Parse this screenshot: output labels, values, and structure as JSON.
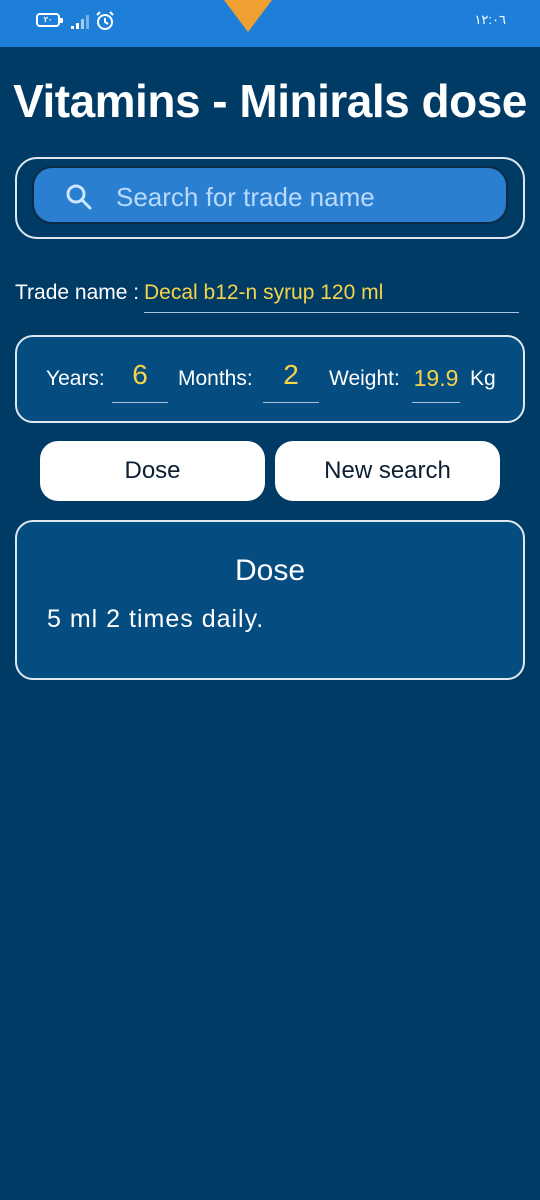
{
  "status_bar": {
    "battery_text": "٢٠",
    "time": "١٢:٠٦",
    "battery_icon": "battery-icon",
    "signal_icon": "signal-icon",
    "alarm_icon": "alarm-clock-icon"
  },
  "title": "Vitamins - Minirals dose",
  "search": {
    "placeholder": "Search for trade name",
    "icon": "search-icon"
  },
  "trade": {
    "label": "Trade name :",
    "value": "Decal b12-n syrup 120 ml"
  },
  "params": {
    "years_label": "Years:",
    "years_value": "6",
    "months_label": "Months:",
    "months_value": "2",
    "weight_label": "Weight:",
    "weight_value": "19.9",
    "weight_unit": "Kg"
  },
  "buttons": {
    "dose": "Dose",
    "new_search": "New search"
  },
  "result": {
    "title": "Dose",
    "text": "5 ml 2 times daily."
  },
  "colors": {
    "background": "#003b66",
    "status_bar": "#1e7fd8",
    "panel": "#054c80",
    "accent_yellow": "#f5d44a"
  }
}
